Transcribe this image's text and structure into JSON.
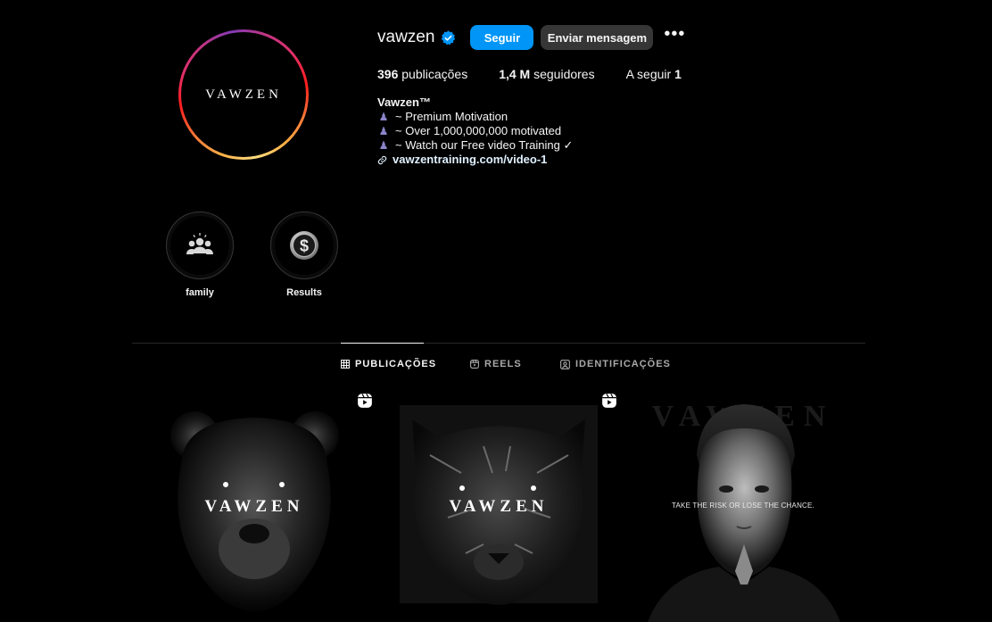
{
  "profile": {
    "avatar_text": "VAWZEN",
    "username": "vawzen",
    "verified_icon": "verified-badge-icon",
    "follow_label": "Seguir",
    "message_label": "Enviar mensagem",
    "more_label": "•••",
    "accent": "#0095f6"
  },
  "stats": {
    "posts_value": "396",
    "posts_label": "publicações",
    "followers_value": "1,4 M",
    "followers_label": "seguidores",
    "following_label": "A seguir",
    "following_value": "1"
  },
  "bio": {
    "name": "Vawzen™",
    "lines": [
      "~ Premium Motivation",
      "~ Over 1,000,000,000 motivated",
      "~ Watch our Free video Training ✓"
    ],
    "bullet": "♟",
    "link": "vawzentraining.com/video-1"
  },
  "highlights": [
    {
      "label": "family",
      "icon": "people-group-icon"
    },
    {
      "label": "Results",
      "icon": "dollar-coin-icon"
    }
  ],
  "tabs": [
    {
      "label": "PUBLICAÇÕES",
      "icon": "grid-icon",
      "active": true
    },
    {
      "label": "REELS",
      "icon": "reels-icon",
      "active": false
    },
    {
      "label": "IDENTIFICAÇÕES",
      "icon": "tagged-icon",
      "active": false
    }
  ],
  "posts": [
    {
      "brand": "VAWZEN",
      "type": "reel",
      "subject": "bear"
    },
    {
      "brand": "VAWZEN",
      "type": "reel",
      "subject": "panther"
    },
    {
      "watermark": "VAWZEN",
      "tagline": "TAKE THE RISK OR LOSE THE CHANCE.",
      "type": "image",
      "subject": "portrait"
    }
  ]
}
